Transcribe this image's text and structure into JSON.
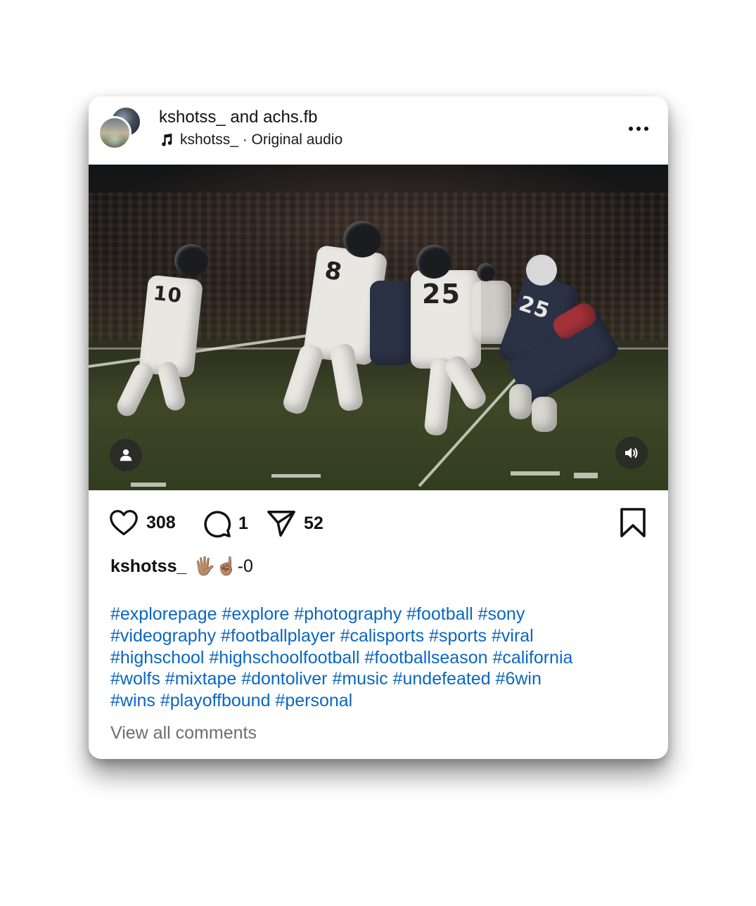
{
  "post": {
    "header": {
      "author_primary": "kshotss_",
      "author_connector": " and ",
      "author_secondary": "achs.fb",
      "audio_author": "kshotss_",
      "audio_separator": " · ",
      "audio_label": "Original audio",
      "icons": {
        "music": "music-note-icon",
        "more": "more-options-icon"
      }
    },
    "media": {
      "type": "video",
      "jersey_numbers": [
        "8",
        "25",
        "10",
        "25"
      ],
      "icons": {
        "tags": "user-tag-icon",
        "sound": "speaker-icon"
      }
    },
    "actions": {
      "likes": "308",
      "comments": "1",
      "shares": "52",
      "icons": {
        "like": "heart-icon",
        "comment": "comment-icon",
        "share": "send-icon",
        "save": "bookmark-icon"
      }
    },
    "caption": {
      "username": "kshotss_",
      "text": "🖐🏽☝🏽-0",
      "hashtag_lines": [
        "#explorepage #explore #photography #football #sony",
        "#videography #footballplayer #calisports #sports #viral",
        "#highschool #highschoolfootball #footballseason #california",
        "#wolfs #mixtape #dontoliver #music #undefeated #6win",
        "#wins #playoffbound #personal"
      ]
    },
    "view_comments_label": "View all comments",
    "colors": {
      "hashtag": "#0a66c2",
      "text": "#111111",
      "muted": "#6e6e6e"
    }
  }
}
